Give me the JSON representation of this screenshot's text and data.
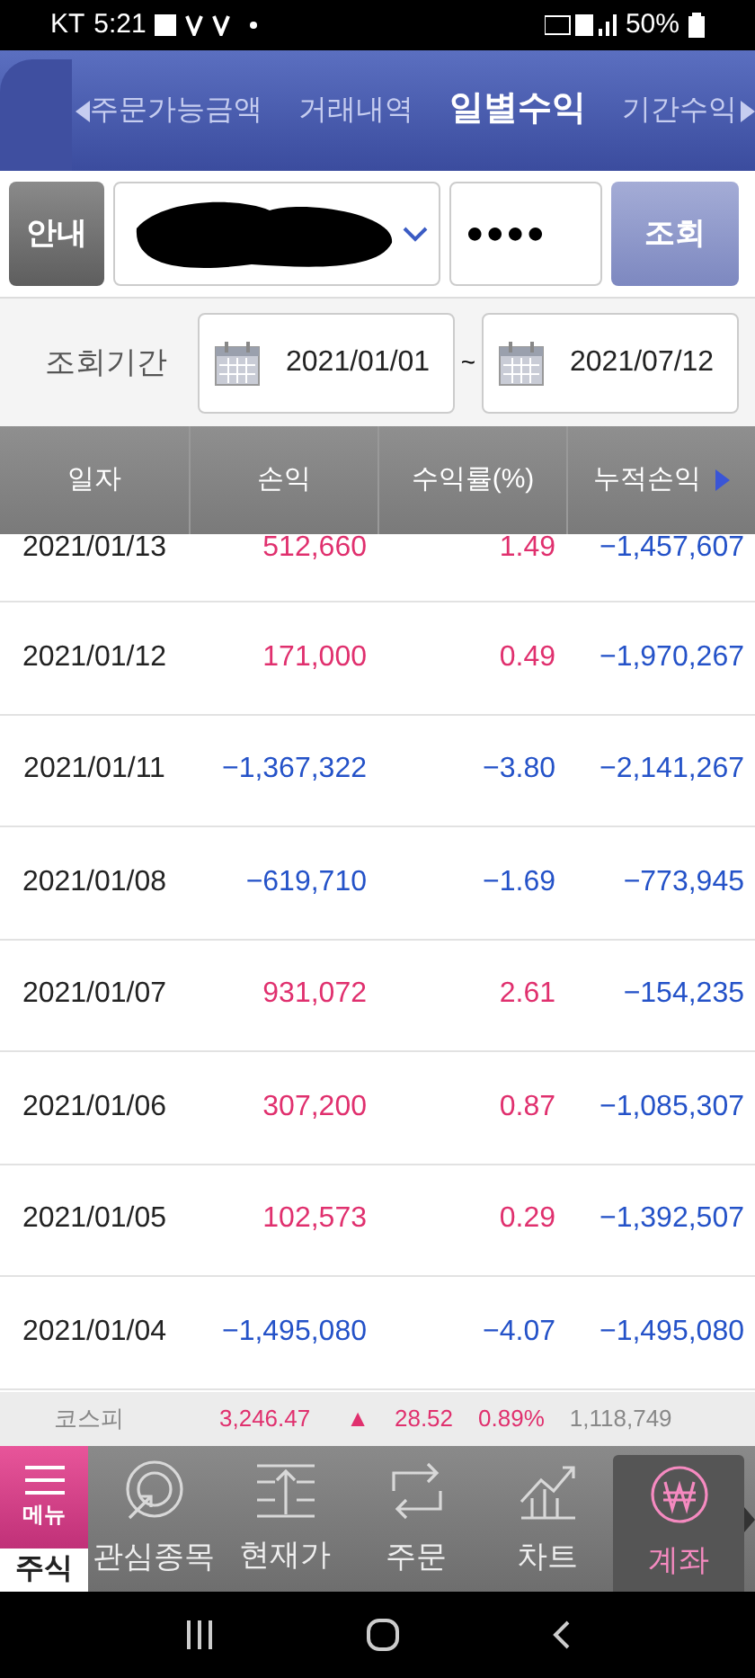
{
  "status_bar": {
    "carrier": "KT",
    "time": "5:21",
    "battery": "50%"
  },
  "tabs": [
    {
      "label": "주문가능금액",
      "selected": false
    },
    {
      "label": "거래내역",
      "selected": false
    },
    {
      "label": "일별수익",
      "selected": true
    },
    {
      "label": "기간수익",
      "selected": false
    }
  ],
  "account_row": {
    "guide_button": "안내",
    "password": "●●●●",
    "search_button": "조회"
  },
  "period": {
    "label": "조회기간",
    "start": "2021/01/01",
    "separator": "~",
    "end": "2021/07/12"
  },
  "table": {
    "columns": [
      "일자",
      "손익",
      "수익률(%)",
      "누적손익"
    ],
    "rows": [
      {
        "clipped": true,
        "cells": [
          {
            "text": "2021/01/13",
            "color": "#222222"
          },
          {
            "text": "512,660",
            "color": "#e0306e"
          },
          {
            "text": "1.49",
            "color": "#e0306e"
          },
          {
            "text": "−1,457,607",
            "color": "#2452c8"
          }
        ]
      },
      {
        "clipped": false,
        "cells": [
          {
            "text": "2021/01/12",
            "color": "#222222"
          },
          {
            "text": "171,000",
            "color": "#e0306e"
          },
          {
            "text": "0.49",
            "color": "#e0306e"
          },
          {
            "text": "−1,970,267",
            "color": "#2452c8"
          }
        ]
      },
      {
        "clipped": false,
        "cells": [
          {
            "text": "2021/01/11",
            "color": "#222222"
          },
          {
            "text": "−1,367,322",
            "color": "#2452c8"
          },
          {
            "text": "−3.80",
            "color": "#2452c8"
          },
          {
            "text": "−2,141,267",
            "color": "#2452c8"
          }
        ]
      },
      {
        "clipped": false,
        "cells": [
          {
            "text": "2021/01/08",
            "color": "#222222"
          },
          {
            "text": "−619,710",
            "color": "#2452c8"
          },
          {
            "text": "−1.69",
            "color": "#2452c8"
          },
          {
            "text": "−773,945",
            "color": "#2452c8"
          }
        ]
      },
      {
        "clipped": false,
        "cells": [
          {
            "text": "2021/01/07",
            "color": "#222222"
          },
          {
            "text": "931,072",
            "color": "#e0306e"
          },
          {
            "text": "2.61",
            "color": "#e0306e"
          },
          {
            "text": "−154,235",
            "color": "#2452c8"
          }
        ]
      },
      {
        "clipped": false,
        "cells": [
          {
            "text": "2021/01/06",
            "color": "#222222"
          },
          {
            "text": "307,200",
            "color": "#e0306e"
          },
          {
            "text": "0.87",
            "color": "#e0306e"
          },
          {
            "text": "−1,085,307",
            "color": "#2452c8"
          }
        ]
      },
      {
        "clipped": false,
        "cells": [
          {
            "text": "2021/01/05",
            "color": "#222222"
          },
          {
            "text": "102,573",
            "color": "#e0306e"
          },
          {
            "text": "0.29",
            "color": "#e0306e"
          },
          {
            "text": "−1,392,507",
            "color": "#2452c8"
          }
        ]
      },
      {
        "clipped": false,
        "cells": [
          {
            "text": "2021/01/04",
            "color": "#222222"
          },
          {
            "text": "−1,495,080",
            "color": "#2452c8"
          },
          {
            "text": "−4.07",
            "color": "#2452c8"
          },
          {
            "text": "−1,495,080",
            "color": "#2452c8"
          }
        ]
      }
    ]
  },
  "ticker": {
    "index": "코스피",
    "value": "3,246.47",
    "arrow": "▲",
    "change": "28.52",
    "percent": "0.89%",
    "volume": "1,118,749"
  },
  "bottom_nav": {
    "menu": "메뉴",
    "market": "주식",
    "items": [
      {
        "label": "관심종목",
        "kind": "target",
        "selected": false
      },
      {
        "label": "현재가",
        "kind": "price",
        "selected": false
      },
      {
        "label": "주문",
        "kind": "order",
        "selected": false
      },
      {
        "label": "차트",
        "kind": "chart",
        "selected": false
      },
      {
        "label": "계좌",
        "kind": "account",
        "selected": true
      }
    ]
  }
}
